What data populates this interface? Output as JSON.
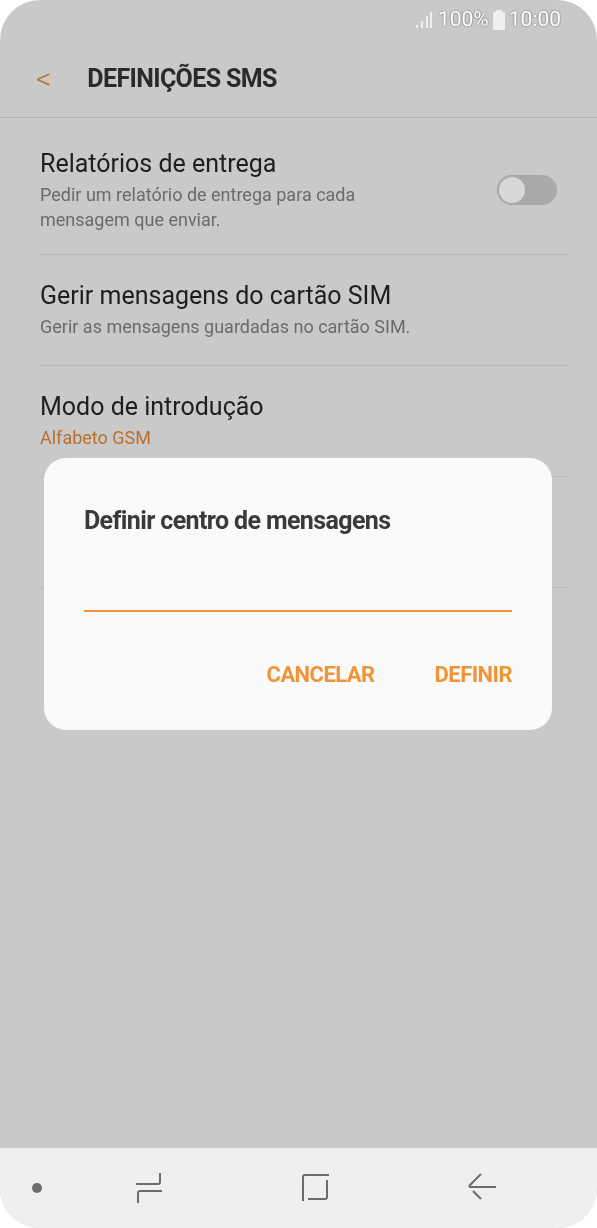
{
  "status_bar": {
    "battery": "100%",
    "time": "10:00"
  },
  "header": {
    "back": "<",
    "title": "DEFINIÇÕES SMS"
  },
  "settings": [
    {
      "kind": "toggle",
      "title": "Relatórios de entrega",
      "subtitle": "Pedir um relatório de entrega para cada mensagem que enviar.",
      "on": false
    },
    {
      "kind": "plain",
      "title": "Gerir mensagens do cartão SIM",
      "subtitle": "Gerir as mensagens guardadas no cartão SIM."
    },
    {
      "kind": "value",
      "title": "Modo de introdução",
      "subtitle": "Alfabeto GSM"
    }
  ],
  "dialog": {
    "title": "Definir centro de mensagens",
    "buttons": [
      "CANCELAR",
      "DEFINIR"
    ]
  }
}
